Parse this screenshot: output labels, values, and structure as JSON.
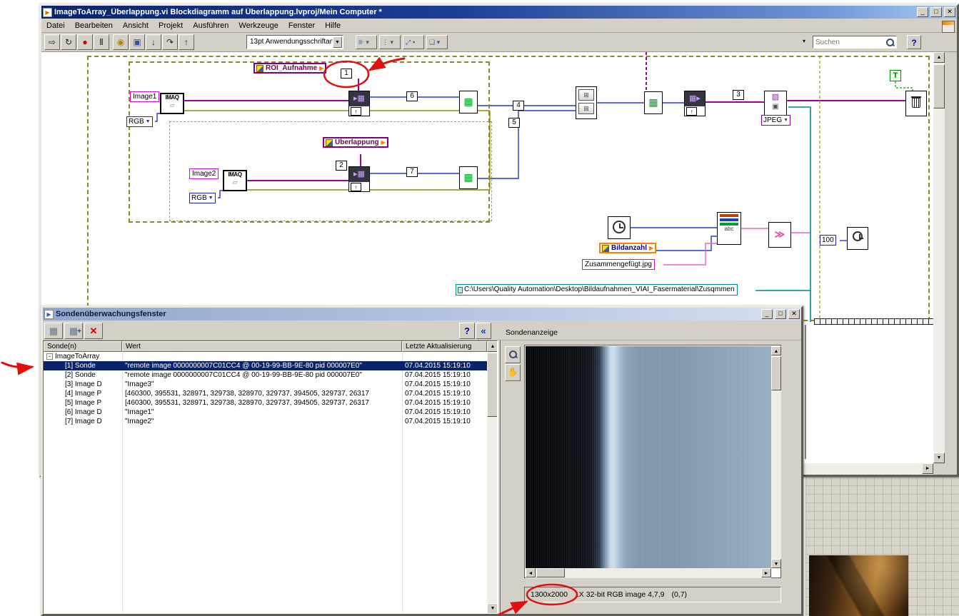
{
  "colors": {
    "selection": "#0a246a",
    "annotation_red": "#e01010",
    "titlebar_blue": "#0a246a"
  },
  "main_window": {
    "title": "ImageToArray_Überlappung.vi Blockdiagramm auf Überlappung.lvproj/Mein Computer *",
    "menu": [
      "Datei",
      "Bearbeiten",
      "Ansicht",
      "Projekt",
      "Ausführen",
      "Werkzeuge",
      "Fenster",
      "Hilfe"
    ],
    "toolbar": {
      "font_selector": "13pt Anwendungsschriftart",
      "search_placeholder": "Suchen",
      "help": "?"
    }
  },
  "diagram": {
    "image1_label": "Image1",
    "image2_label": "Image2",
    "rgb_selector": "RGB",
    "imaq_label": "IMAQ",
    "roi_probe_label": "ROI_Aufnahme",
    "ueberlappung_probe_label": "Überlappung",
    "bildanzahl_probe_label": "Bildanzahl",
    "filename_constant": "Zusammengefügt.jpg",
    "path_constant": "C:\\Users\\Quality Automation\\Desktop\\Bildaufnahmen_VIAI_Fasermaterial\\Zusqmmen",
    "jpeg_selector": "JPEG",
    "true_constant": "T",
    "wait_ms_constant": "100",
    "probes": {
      "p1": "1",
      "p2": "2",
      "p3": "3",
      "p4": "4",
      "p5": "5",
      "p6": "6",
      "p7": "7"
    }
  },
  "probe_window": {
    "title": "Sondenüberwachungsfenster",
    "toolbar": {
      "help": "?",
      "collapse": "«"
    },
    "columns": {
      "c1": "Sonde(n)",
      "c2": "Wert",
      "c3": "Letzte Aktualisierung"
    },
    "tree_root": "ImageToArray",
    "rows": [
      {
        "name": "[1] Sonde",
        "value": "\"remote image 0000000007C01CC4 @ 00-19-99-BB-9E-80 pid 000007E0\"",
        "time": "07.04.2015 15:19:10"
      },
      {
        "name": "[2] Sonde",
        "value": "\"remote image 0000000007C01CC4 @ 00-19-99-BB-9E-80 pid 000007E0\"",
        "time": "07.04.2015 15:19:10"
      },
      {
        "name": "[3] Image D",
        "value": "\"Image3\"",
        "time": "07.04.2015 15:19:10"
      },
      {
        "name": "[4] Image P",
        "value": "[460300, 395531, 328971, 329738, 328970, 329737, 394505, 329737, 26317",
        "time": "07.04.2015 15:19:10"
      },
      {
        "name": "[5] Image P",
        "value": "[460300, 395531, 328971, 329738, 328970, 329737, 394505, 329737, 26317",
        "time": "07.04.2015 15:19:10"
      },
      {
        "name": "[6] Image D",
        "value": "\"Image1\"",
        "time": "07.04.2015 15:19:10"
      },
      {
        "name": "[7] Image D",
        "value": "\"Image2\"",
        "time": "07.04.2015 15:19:10"
      }
    ],
    "display": {
      "label": "Sondenanzeige",
      "size_value": "1300x2000",
      "status_info": "1X 32-bit RGB image 4,7,9",
      "status_coords": "(0,7)"
    }
  }
}
